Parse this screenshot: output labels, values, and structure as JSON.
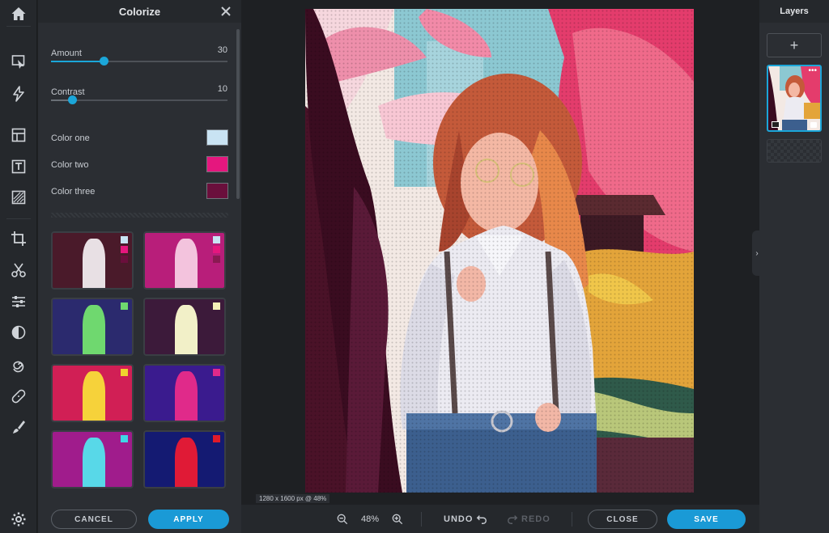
{
  "panel": {
    "title": "Colorize",
    "amount": {
      "label": "Amount",
      "value": "30",
      "level": 0.3
    },
    "contrast": {
      "label": "Contrast",
      "value": "10",
      "level": 0.12
    },
    "colors": [
      {
        "label": "Color one",
        "hex": "#c9e3f3"
      },
      {
        "label": "Color two",
        "hex": "#e5177e"
      },
      {
        "label": "Color three",
        "hex": "#6a0f3c"
      }
    ],
    "cancel_label": "CANCEL",
    "apply_label": "APPLY"
  },
  "presets": [
    {
      "bg": "#4a1a2a",
      "fig": "#e8e0e4",
      "dots": [
        "#c9e3f3",
        "#e5177e",
        "#6a0f3c"
      ]
    },
    {
      "bg": "#b81e7a",
      "fig": "#f3c3dd",
      "dots": [
        "#c9e3f3",
        "#e5177e",
        "#8a1a52"
      ]
    },
    {
      "bg": "#2b2a6e",
      "fig": "#6fd86f",
      "dots": [
        "#6fd86f"
      ]
    },
    {
      "bg": "#3c1a3a",
      "fig": "#f2f0c8",
      "dots": [
        "#f4f1b8"
      ]
    },
    {
      "bg": "#d11f55",
      "fig": "#f6d23a",
      "dots": [
        "#f0d22e"
      ]
    },
    {
      "bg": "#3a1b8e",
      "fig": "#e02a8a",
      "dots": [
        "#e02a8a"
      ]
    },
    {
      "bg": "#a01c8c",
      "fig": "#58d8e8",
      "dots": [
        "#3fd6e6"
      ]
    },
    {
      "bg": "#141a72",
      "fig": "#e01a36",
      "dots": [
        "#e01a2a"
      ]
    }
  ],
  "stage": {
    "size_info": "1280 x 1600 px @ 48%"
  },
  "toolbar": {
    "zoom": "48%",
    "undo_label": "UNDO",
    "redo_label": "REDO",
    "close_label": "CLOSE",
    "save_label": "SAVE"
  },
  "layers": {
    "title": "Layers",
    "add_symbol": "+"
  },
  "colors": {
    "accent": "#1ba6d9",
    "button_primary": "#1a9ad6"
  }
}
